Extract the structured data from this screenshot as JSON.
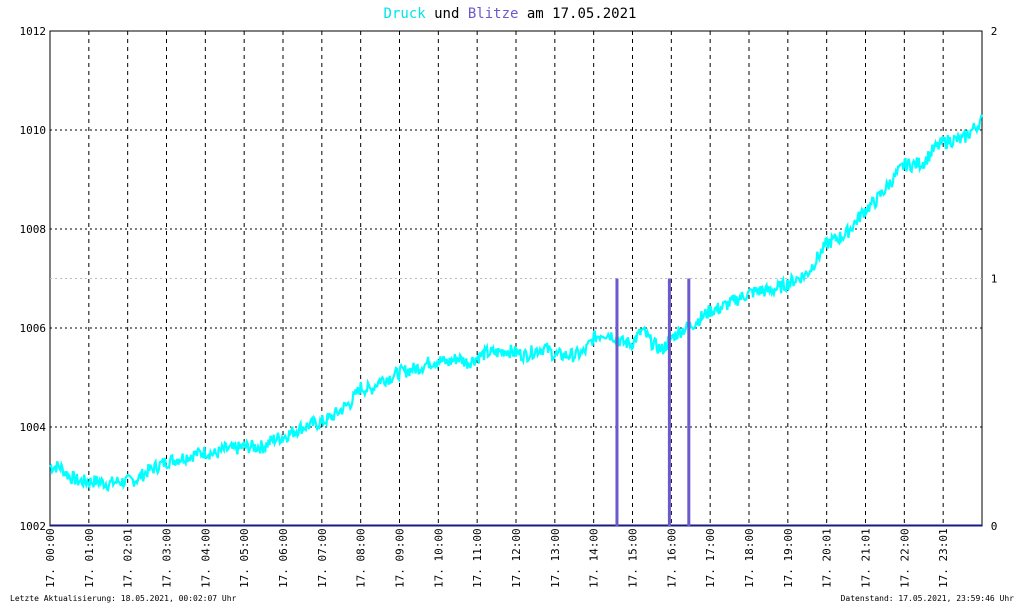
{
  "chart_data": {
    "type": "line",
    "title": {
      "parts": [
        {
          "text": "Druck",
          "color": "#00e5e5"
        },
        {
          "text": " und ",
          "color": "#000000"
        },
        {
          "text": "Blitze",
          "color": "#6a5acd"
        },
        {
          "text": " am 17.05.2021",
          "color": "#000000"
        }
      ]
    },
    "x_range_hours": [
      0,
      24
    ],
    "y_left": {
      "min": 1002,
      "max": 1012,
      "ticks": [
        1002,
        1004,
        1006,
        1008,
        1010,
        1012
      ]
    },
    "y_right": {
      "min": 0,
      "max": 2,
      "ticks": [
        0,
        1,
        2
      ]
    },
    "x_tick_labels": [
      {
        "h": 0,
        "label": "17. 00:00"
      },
      {
        "h": 1,
        "label": "17. 01:00"
      },
      {
        "h": 2,
        "label": "17. 02:01"
      },
      {
        "h": 3,
        "label": "17. 03:00"
      },
      {
        "h": 4,
        "label": "17. 04:00"
      },
      {
        "h": 5,
        "label": "17. 05:00"
      },
      {
        "h": 6,
        "label": "17. 06:00"
      },
      {
        "h": 7,
        "label": "17. 07:00"
      },
      {
        "h": 8,
        "label": "17. 08:00"
      },
      {
        "h": 9,
        "label": "17. 09:00"
      },
      {
        "h": 10,
        "label": "17. 10:00"
      },
      {
        "h": 11,
        "label": "17. 11:00"
      },
      {
        "h": 12,
        "label": "17. 12:00"
      },
      {
        "h": 13,
        "label": "17. 13:00"
      },
      {
        "h": 14,
        "label": "17. 14:00"
      },
      {
        "h": 15,
        "label": "17. 15:00"
      },
      {
        "h": 16,
        "label": "17. 16:00"
      },
      {
        "h": 17,
        "label": "17. 17:00"
      },
      {
        "h": 18,
        "label": "17. 18:00"
      },
      {
        "h": 19,
        "label": "17. 19:00"
      },
      {
        "h": 20,
        "label": "17. 20:01"
      },
      {
        "h": 21,
        "label": "17. 21:01"
      },
      {
        "h": 22,
        "label": "17. 22:00"
      },
      {
        "h": 23,
        "label": "17. 23:01"
      }
    ],
    "series": [
      {
        "name": "Druck",
        "color": "#00ffff",
        "axis": "left",
        "points": [
          [
            0.0,
            1003.2
          ],
          [
            0.25,
            1003.2
          ],
          [
            0.5,
            1003.0
          ],
          [
            0.75,
            1002.9
          ],
          [
            1.0,
            1002.9
          ],
          [
            1.25,
            1002.9
          ],
          [
            1.5,
            1002.85
          ],
          [
            1.75,
            1002.9
          ],
          [
            2.0,
            1002.9
          ],
          [
            2.25,
            1002.95
          ],
          [
            2.5,
            1003.1
          ],
          [
            2.75,
            1003.2
          ],
          [
            3.0,
            1003.3
          ],
          [
            3.25,
            1003.35
          ],
          [
            3.5,
            1003.4
          ],
          [
            3.75,
            1003.45
          ],
          [
            4.0,
            1003.5
          ],
          [
            4.25,
            1003.45
          ],
          [
            4.5,
            1003.55
          ],
          [
            4.75,
            1003.55
          ],
          [
            5.0,
            1003.6
          ],
          [
            5.25,
            1003.6
          ],
          [
            5.5,
            1003.6
          ],
          [
            5.75,
            1003.75
          ],
          [
            6.0,
            1003.8
          ],
          [
            6.25,
            1003.9
          ],
          [
            6.5,
            1004.0
          ],
          [
            6.75,
            1004.05
          ],
          [
            7.0,
            1004.1
          ],
          [
            7.25,
            1004.2
          ],
          [
            7.5,
            1004.35
          ],
          [
            7.75,
            1004.5
          ],
          [
            8.0,
            1004.8
          ],
          [
            8.25,
            1004.75
          ],
          [
            8.5,
            1004.95
          ],
          [
            8.75,
            1005.0
          ],
          [
            9.0,
            1005.1
          ],
          [
            9.25,
            1005.15
          ],
          [
            9.5,
            1005.2
          ],
          [
            9.75,
            1005.3
          ],
          [
            10.0,
            1005.35
          ],
          [
            10.25,
            1005.3
          ],
          [
            10.5,
            1005.4
          ],
          [
            10.75,
            1005.3
          ],
          [
            11.0,
            1005.4
          ],
          [
            11.25,
            1005.5
          ],
          [
            11.5,
            1005.5
          ],
          [
            11.75,
            1005.55
          ],
          [
            12.0,
            1005.5
          ],
          [
            12.25,
            1005.45
          ],
          [
            12.5,
            1005.55
          ],
          [
            12.75,
            1005.6
          ],
          [
            13.0,
            1005.45
          ],
          [
            13.25,
            1005.45
          ],
          [
            13.5,
            1005.45
          ],
          [
            13.75,
            1005.5
          ],
          [
            14.0,
            1005.8
          ],
          [
            14.25,
            1005.9
          ],
          [
            14.5,
            1005.85
          ],
          [
            14.75,
            1005.7
          ],
          [
            15.0,
            1005.7
          ],
          [
            15.25,
            1005.95
          ],
          [
            15.5,
            1005.7
          ],
          [
            15.75,
            1005.55
          ],
          [
            16.0,
            1005.8
          ],
          [
            16.25,
            1005.95
          ],
          [
            16.5,
            1006.05
          ],
          [
            16.75,
            1006.2
          ],
          [
            17.0,
            1006.35
          ],
          [
            17.25,
            1006.4
          ],
          [
            17.5,
            1006.5
          ],
          [
            17.75,
            1006.6
          ],
          [
            18.0,
            1006.7
          ],
          [
            18.25,
            1006.75
          ],
          [
            18.5,
            1006.75
          ],
          [
            18.75,
            1006.8
          ],
          [
            19.0,
            1006.9
          ],
          [
            19.25,
            1007.0
          ],
          [
            19.5,
            1007.1
          ],
          [
            19.75,
            1007.4
          ],
          [
            20.0,
            1007.7
          ],
          [
            20.25,
            1007.8
          ],
          [
            20.5,
            1007.9
          ],
          [
            20.75,
            1008.15
          ],
          [
            21.0,
            1008.4
          ],
          [
            21.25,
            1008.55
          ],
          [
            21.5,
            1008.8
          ],
          [
            21.75,
            1009.05
          ],
          [
            22.0,
            1009.3
          ],
          [
            22.25,
            1009.3
          ],
          [
            22.5,
            1009.35
          ],
          [
            22.75,
            1009.6
          ],
          [
            23.0,
            1009.75
          ],
          [
            23.25,
            1009.8
          ],
          [
            23.5,
            1009.8
          ],
          [
            23.75,
            1010.0
          ],
          [
            24.0,
            1010.2
          ]
        ]
      },
      {
        "name": "Blitze",
        "color": "#6a5acd",
        "axis": "right",
        "type": "bar",
        "points": [
          [
            14.6,
            1
          ],
          [
            15.95,
            1
          ],
          [
            16.45,
            1
          ]
        ]
      }
    ],
    "grid": true,
    "legend": "title"
  },
  "footer": {
    "left": "Letzte Aktualisierung: 18.05.2021, 00:02:07 Uhr",
    "right": "Datenstand: 17.05.2021, 23:59:46 Uhr"
  }
}
